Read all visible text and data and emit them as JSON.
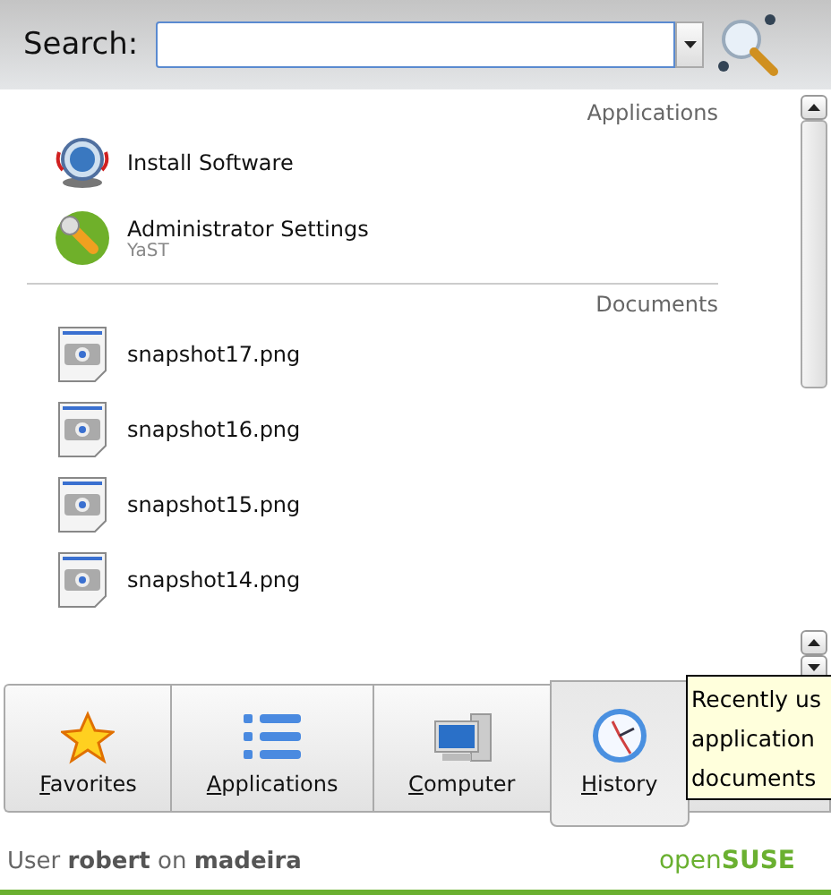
{
  "search": {
    "label": "Search:"
  },
  "sections": [
    {
      "title": "Applications",
      "items": [
        {
          "kind": "install",
          "name": "Install Software"
        },
        {
          "kind": "admin",
          "name": "Administrator Settings",
          "subtitle": "YaST"
        }
      ]
    },
    {
      "title": "Documents",
      "items": [
        {
          "kind": "image",
          "name": "snapshot17.png"
        },
        {
          "kind": "image",
          "name": "snapshot16.png"
        },
        {
          "kind": "image",
          "name": "snapshot15.png"
        },
        {
          "kind": "image",
          "name": "snapshot14.png"
        }
      ]
    }
  ],
  "tabs": [
    {
      "kind": "favorites",
      "label": "Favorites",
      "selected": false
    },
    {
      "kind": "applications",
      "label": "Applications",
      "selected": false
    },
    {
      "kind": "computer",
      "label": "Computer",
      "selected": false
    },
    {
      "kind": "history",
      "label": "History",
      "selected": true
    }
  ],
  "tooltip": {
    "lines": [
      "Recently us",
      "application",
      "documents"
    ]
  },
  "footer": {
    "user": "User **robert** on **madeira**",
    "logo": "open**SUSE**"
  }
}
